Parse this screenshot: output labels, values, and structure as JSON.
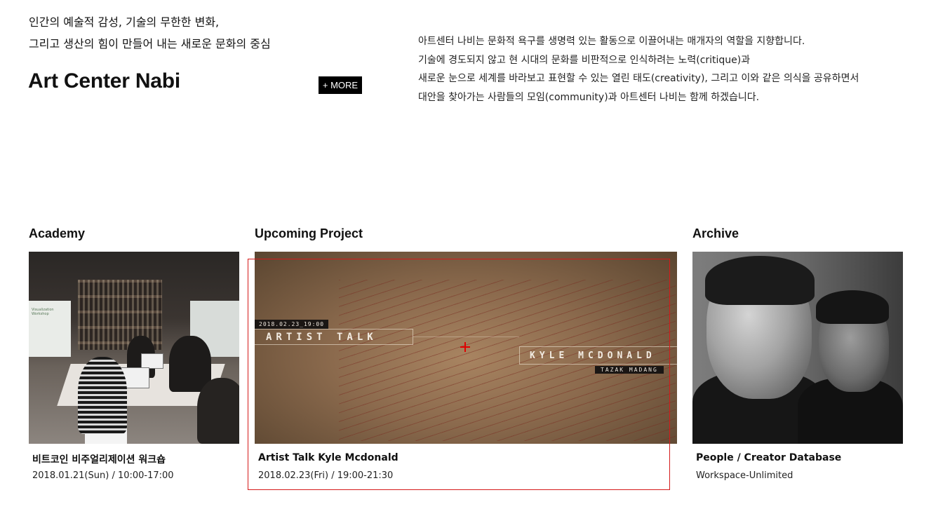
{
  "intro": {
    "tagline_line1": "인간의 예술적 감성, 기술의 무한한 변화,",
    "tagline_line2": "그리고 생산의 힘이 만들어 내는 새로운 문화의 중심",
    "title": "Art Center Nabi",
    "more_label": "+ MORE",
    "mission_lines": [
      "아트센터 나비는 문화적 욕구를 생명력 있는 활동으로 이끌어내는 매개자의 역할을 지향합니다.",
      "기술에 경도되지 않고 현 시대의 문화를 비판적으로 인식하려는 노력(critique)과",
      "새로운 눈으로 세계를 바라보고 표현할 수 있는 열린 태도(creativity), 그리고 이와 같은 의식을 공유하면서",
      "대안을 찾아가는 사람들의 모임(community)과 아트센터 나비는 함께 하겠습니다."
    ]
  },
  "sections": {
    "academy": {
      "heading": "Academy",
      "title": "비트코인 비주얼리제이션 워크숍",
      "subtitle": "2018.01.21(Sun) / 10:00-17:00",
      "image_caption": "Visualization Workshop"
    },
    "upcoming": {
      "heading": "Upcoming Project",
      "title": "Artist Talk Kyle Mcdonald",
      "subtitle": "2018.02.23(Fri) / 19:00-21:30",
      "poster": {
        "date_tag": "2018.02.23_19:00",
        "talk_label": "ARTIST TALK",
        "artist_label": "KYLE MCDONALD",
        "venue_tag": "TAZAK MADANG"
      }
    },
    "archive": {
      "heading": "Archive",
      "title": "People / Creator Database",
      "subtitle": "Workspace-Unlimited"
    }
  },
  "colors": {
    "highlight": "#d51a1a",
    "button_bg": "#000000",
    "button_fg": "#ffffff"
  }
}
